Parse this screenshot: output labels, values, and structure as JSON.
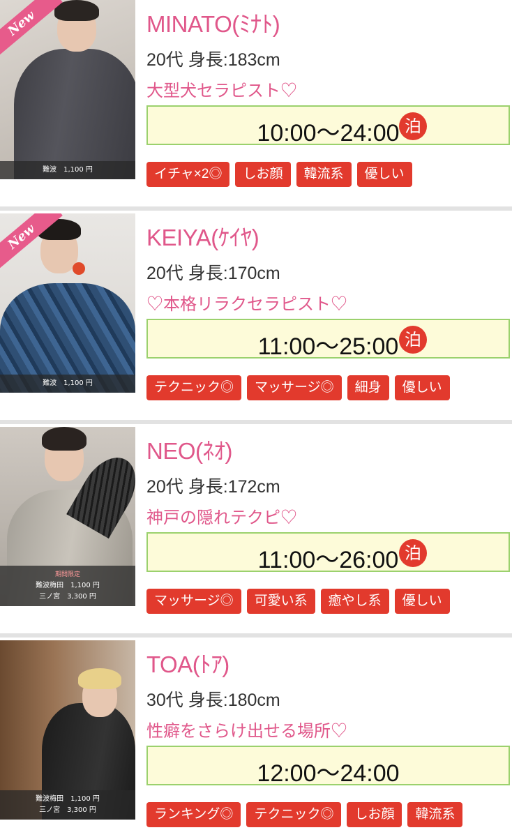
{
  "colors": {
    "accent_pink": "#e0578a",
    "tag_red": "#e23a2d",
    "hours_bg": "#fdfbd9",
    "hours_border": "#9bd16d"
  },
  "therapists": [
    {
      "new_badge": "New",
      "name": "MINATO(ﾐﾅﾄ)",
      "info": "20代 身長:183cm",
      "catch": "大型犬セラピスト♡",
      "hours": "10:00〜24:00",
      "stay": "泊",
      "price_lines": [
        "難波　1,100 円"
      ],
      "tags": [
        "イチャ×2◎",
        "しお顔",
        "韓流系",
        "優しい"
      ]
    },
    {
      "new_badge": "New",
      "name": "KEIYA(ｹｲﾔ)",
      "info": "20代 身長:170cm",
      "catch": "♡本格リラクセラピスト♡",
      "hours": "11:00〜25:00",
      "stay": "泊",
      "price_lines": [
        "難波　1,100 円"
      ],
      "tags": [
        "テクニック◎",
        "マッサージ◎",
        "細身",
        "優しい"
      ]
    },
    {
      "name": "NEO(ﾈｵ)",
      "info": "20代 身長:172cm",
      "catch": "神戸の隠れテクピ♡",
      "hours": "11:00〜26:00",
      "stay": "泊",
      "price_limited": "期間限定",
      "price_lines": [
        "難波梅田　1,100 円",
        "三ノ宮　3,300 円"
      ],
      "tags": [
        "マッサージ◎",
        "可愛い系",
        "癒やし系",
        "優しい"
      ]
    },
    {
      "name": "TOA(ﾄｱ)",
      "info": "30代 身長:180cm",
      "catch": "性癖をさらけ出せる場所♡",
      "hours": "12:00〜24:00",
      "price_lines": [
        "難波梅田　1,100 円",
        "三ノ宮　3,300 円"
      ],
      "tags": [
        "ランキング◎",
        "テクニック◎",
        "しお顔",
        "韓流系"
      ]
    }
  ]
}
